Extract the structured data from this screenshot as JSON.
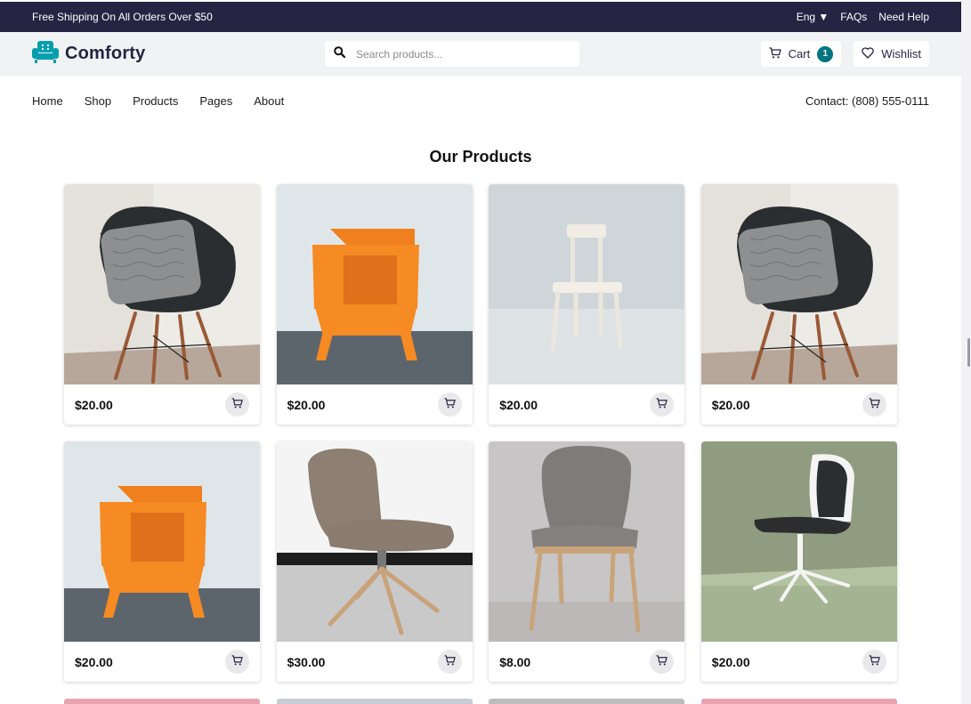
{
  "topbar": {
    "promo": "Free Shipping On All Orders Over $50",
    "language": "Eng",
    "faqs": "FAQs",
    "help": "Need Help"
  },
  "header": {
    "brand": "Comforty",
    "search_placeholder": "Search products...",
    "cart_label": "Cart",
    "cart_count": "1",
    "wishlist_label": "Wishlist"
  },
  "nav": {
    "items": [
      "Home",
      "Shop",
      "Products",
      "Pages",
      "About"
    ],
    "contact_label": "Contact:",
    "contact_phone": "(808) 555-0111"
  },
  "section_title": "Our Products",
  "products": [
    {
      "price": "$20.00",
      "image": "black-shell-chair-with-pillow"
    },
    {
      "price": "$20.00",
      "image": "orange-plastic-chair"
    },
    {
      "price": "$20.00",
      "image": "white-wooden-chair"
    },
    {
      "price": "$20.00",
      "image": "black-shell-chair-with-pillow"
    },
    {
      "price": "$20.00",
      "image": "orange-plastic-chair"
    },
    {
      "price": "$30.00",
      "image": "gray-lounge-swivel-chair"
    },
    {
      "price": "$8.00",
      "image": "gray-upholstered-wood-chair"
    },
    {
      "price": "$20.00",
      "image": "white-office-chair"
    }
  ],
  "colors": {
    "topbar": "#272343",
    "accent": "#007580",
    "header_bg": "#f0f2f3"
  }
}
